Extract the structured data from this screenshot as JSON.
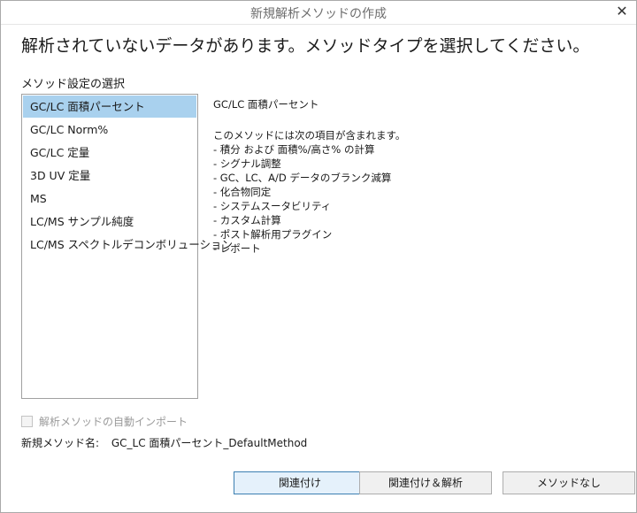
{
  "window": {
    "title": "新規解析メソッドの作成",
    "close_glyph": "✕"
  },
  "headline": "解析されていないデータがあります。メソッドタイプを選択してください。",
  "method_list": {
    "label": "メソッド設定の選択",
    "items": [
      {
        "label": "GC/LC 面積パーセント",
        "selected": true
      },
      {
        "label": "GC/LC Norm%",
        "selected": false
      },
      {
        "label": "GC/LC 定量",
        "selected": false
      },
      {
        "label": "3D UV 定量",
        "selected": false
      },
      {
        "label": "MS",
        "selected": false
      },
      {
        "label": "LC/MS サンプル純度",
        "selected": false
      },
      {
        "label": "LC/MS スペクトルデコンボリューション",
        "selected": false
      }
    ]
  },
  "detail": {
    "title": "GC/LC 面積パーセント",
    "lines": [
      "このメソッドには次の項目が含まれます。",
      "- 積分 および 面積%/高さ% の計算",
      "- シグナル調整",
      "- GC、LC、A/D データのブランク減算",
      "- 化合物同定",
      "- システムスータビリティ",
      "- カスタム計算",
      "- ポスト解析用プラグイン",
      "- レポート"
    ]
  },
  "auto_import": {
    "label": "解析メソッドの自動インポート",
    "checked": false,
    "enabled": false
  },
  "new_method": {
    "label": "新規メソッド名:",
    "value": "GC_LC 面積パーセント_DefaultMethod"
  },
  "buttons": {
    "associate": "関連付け",
    "associate_analyze": "関連付け＆解析",
    "no_method": "メソッドなし"
  },
  "colors": {
    "selection": "#a9d1ee",
    "primary_border": "#3c7fb1"
  }
}
